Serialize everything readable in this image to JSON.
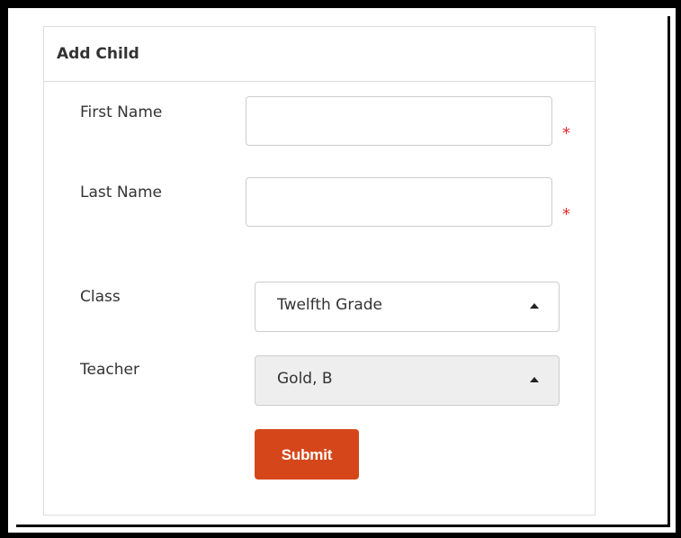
{
  "panel": {
    "title": "Add Child"
  },
  "form": {
    "first_name": {
      "label": "First Name",
      "value": "",
      "required_marker": "*"
    },
    "last_name": {
      "label": "Last Name",
      "value": "",
      "required_marker": "*"
    },
    "class": {
      "label": "Class",
      "selected": "Twelfth Grade"
    },
    "teacher": {
      "label": "Teacher",
      "selected": "Gold, B"
    },
    "submit_label": "Submit"
  },
  "colors": {
    "accent": "#d5471b",
    "required": "#e22b2b",
    "disabled_bg": "#eeeeee"
  },
  "icons": {
    "select_caret": "caret-up-icon"
  }
}
